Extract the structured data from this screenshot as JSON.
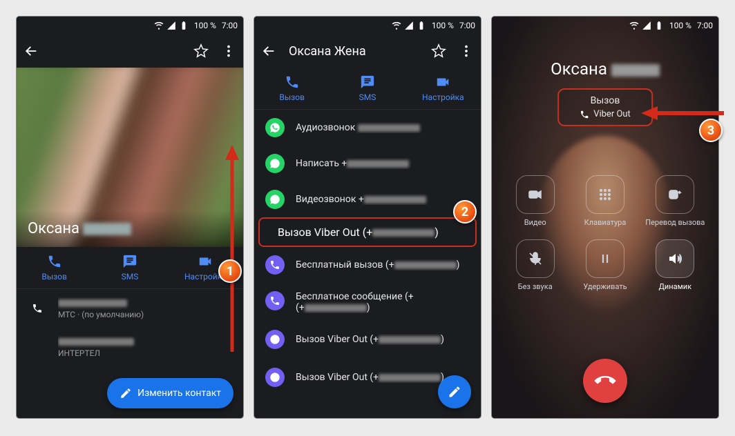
{
  "status": {
    "percent": "100 %",
    "time": "7:00"
  },
  "annotations": {
    "step1": "1",
    "step2": "2",
    "step3": "3"
  },
  "phone1": {
    "contact_name": "Оксана",
    "tabs": {
      "call": "Вызов",
      "sms": "SMS",
      "settings": "Настройка"
    },
    "row1_sub": "МТС · (по умолчанию)",
    "row2_sub": "ИНТЕРТЕЛ",
    "fab": "Изменить контакт"
  },
  "phone2": {
    "title": "Оксана Жена",
    "tabs": {
      "call": "Вызов",
      "sms": "SMS",
      "settings": "Настройка"
    },
    "rows": {
      "wa_audio": "Аудиозвонок",
      "wa_write": "Написать +",
      "wa_video": "Видеозвонок +",
      "vb_out1": "Вызов Viber Out (+",
      "vb_free_call": "Бесплатный вызов (+",
      "vb_free_msg": "Бесплатное сообщение (+",
      "vb_out2": "Вызов Viber Out (+",
      "vb_out3": "Вызов Viber Out (+"
    }
  },
  "phone3": {
    "name": "Оксана",
    "status1": "Вызов",
    "status2": "Viber Out",
    "buttons": {
      "video": "Видео",
      "keypad": "Клавиатура",
      "transfer": "Перевод вызова",
      "mute": "Без звука",
      "hold": "Удерживать",
      "speaker": "Динамик"
    }
  }
}
